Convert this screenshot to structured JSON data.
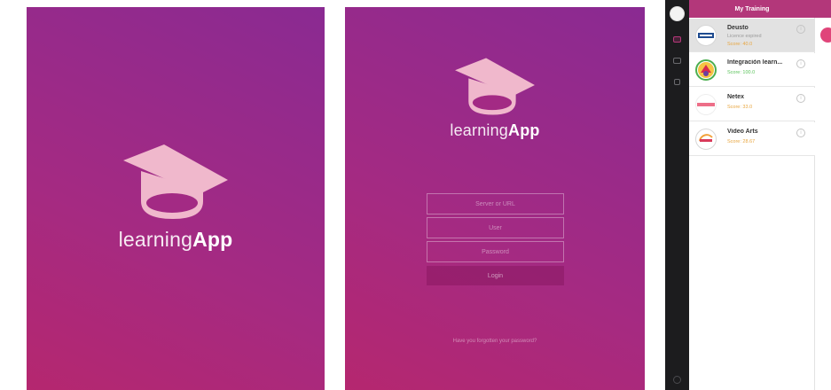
{
  "splash": {
    "brand_light": "learning",
    "brand_bold": "App"
  },
  "login": {
    "brand_light": "learning",
    "brand_bold": "App",
    "server_placeholder": "Server or URL",
    "user_placeholder": "User",
    "password_placeholder": "Password",
    "login_label": "Login",
    "forgot_password": "Have you forgotten your password?"
  },
  "my_training": {
    "header_title": "My Training",
    "courses": [
      {
        "name": "Deusto",
        "status": "Licence expired",
        "score": "Score: 40.0",
        "score_color": "#e8a640",
        "logo": "deusto-logo",
        "selected": true
      },
      {
        "name": "Integración learn...",
        "status": "",
        "score": "Score: 100.0",
        "score_color": "#5cc35c",
        "logo": "integracion-logo",
        "selected": false
      },
      {
        "name": "Netex",
        "status": "",
        "score": "Score: 33.0",
        "score_color": "#e8a640",
        "logo": "netex-logo",
        "selected": false
      },
      {
        "name": "Video Arts",
        "status": "",
        "score": "Score: 28.67",
        "score_color": "#e8a640",
        "logo": "video-arts-logo",
        "selected": false
      }
    ]
  },
  "colors": {
    "brand_magenta": "#b3377a",
    "gradient_start": "#b5276f",
    "gradient_end": "#8a2a92",
    "sidebar_dark": "#1c1c1e"
  }
}
